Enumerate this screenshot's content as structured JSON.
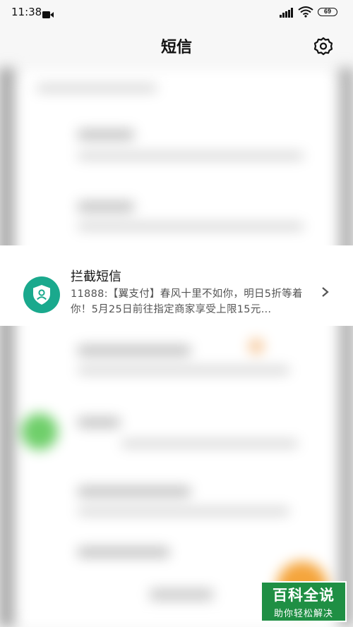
{
  "status_bar": {
    "time": "11:38",
    "icons": [
      "video-icon",
      "signal-icon",
      "wifi-icon",
      "battery-icon"
    ],
    "battery": "69"
  },
  "header": {
    "title": "短信",
    "settings_icon": "gear-icon"
  },
  "blocked_messages": {
    "title": "拦截短信",
    "preview": "11888:【翼支付】春风十里不如你，明日5折等着你！5月25日前往指定商家享受上限15元…",
    "icon": "shield-person-icon",
    "chevron": "chevron-right-icon"
  },
  "watermark": {
    "line1": "百科全说",
    "line2": "助你轻松解决"
  },
  "colors": {
    "accent": "#1aa98d",
    "watermark": "#1f8f44",
    "background": "#f7f7f7"
  }
}
